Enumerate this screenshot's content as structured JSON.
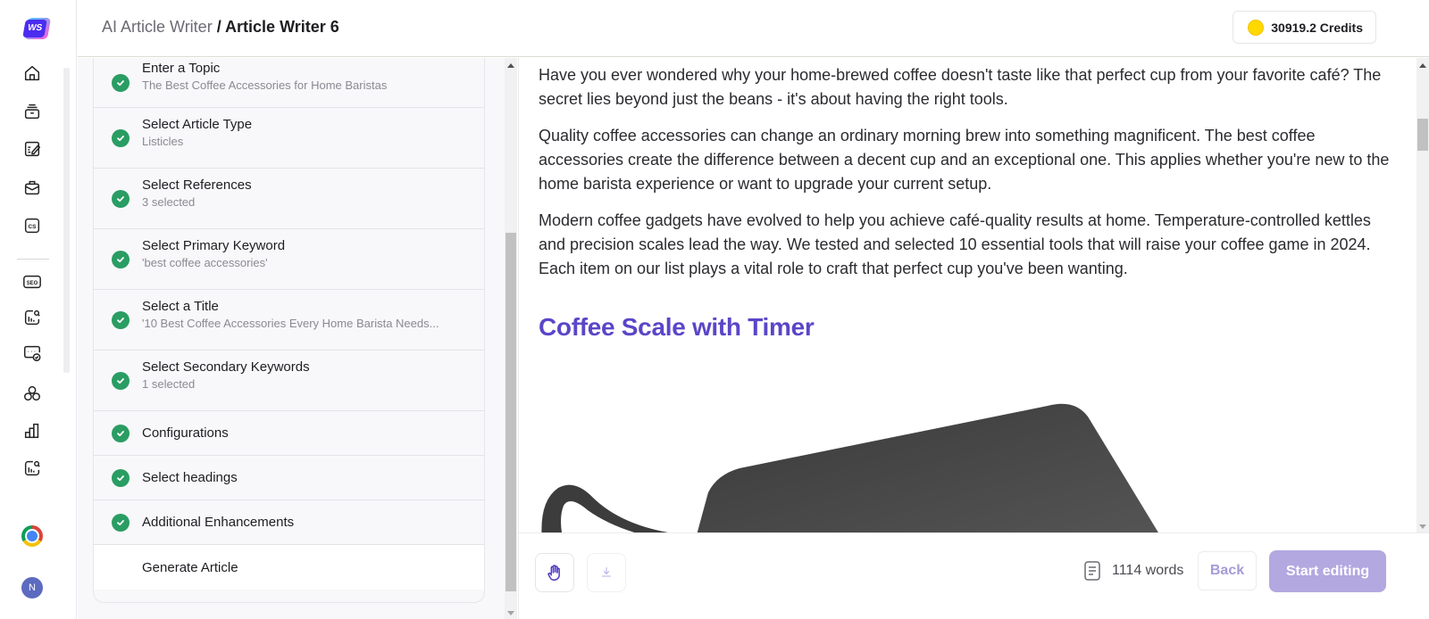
{
  "app": {
    "logo_text": "WS"
  },
  "rail": {
    "items": [
      {
        "icon": "home-icon"
      },
      {
        "icon": "archive-icon"
      },
      {
        "icon": "edit-document-icon"
      },
      {
        "icon": "briefcase-icon"
      },
      {
        "icon": "cs-icon",
        "glyph": "CS"
      },
      {
        "icon": "seo-icon",
        "glyph": "SEO"
      },
      {
        "icon": "analytics-search-icon"
      },
      {
        "icon": "message-check-icon"
      },
      {
        "icon": "community-icon"
      },
      {
        "icon": "bar-chart-icon"
      },
      {
        "icon": "analytics-search-icon-2"
      }
    ],
    "chrome_icon": "chrome-icon",
    "avatar_initial": "N"
  },
  "header": {
    "breadcrumb_root": "AI Article Writer",
    "breadcrumb_sep": " / ",
    "breadcrumb_current": "Article Writer 6",
    "credits": "30919.2 Credits"
  },
  "steps": [
    {
      "title": "Enter a Topic",
      "subtitle": "The Best Coffee Accessories for Home Baristas",
      "done": true
    },
    {
      "title": "Select Article Type",
      "subtitle": "Listicles",
      "done": true
    },
    {
      "title": "Select References",
      "subtitle": "3 selected",
      "done": true
    },
    {
      "title": "Select Primary Keyword",
      "subtitle": "'best coffee accessories'",
      "done": true
    },
    {
      "title": "Select a Title",
      "subtitle": "'10 Best Coffee Accessories Every Home Barista Needs...",
      "done": true
    },
    {
      "title": "Select Secondary Keywords",
      "subtitle": "1 selected",
      "done": true
    },
    {
      "title": "Configurations",
      "done": true
    },
    {
      "title": "Select headings",
      "done": true
    },
    {
      "title": "Additional Enhancements",
      "done": true
    },
    {
      "title": "Generate Article",
      "done": false
    }
  ],
  "article": {
    "paragraphs": [
      "Have you ever wondered why your home-brewed coffee doesn't taste like that perfect cup from your favorite café? The secret lies beyond just the beans - it's about having the right tools.",
      "Quality coffee accessories can change an ordinary morning brew into something magnificent. The best coffee accessories create the difference between a decent cup and an exceptional one. This applies whether you're new to the home barista experience or want to upgrade your current setup.",
      "Modern coffee gadgets have evolved to help you achieve café-quality results at home. Temperature-controlled kettles and precision scales lead the way. We tested and selected 10 essential tools that will raise your coffee game in 2024. Each item on our list plays a vital role to craft that perfect cup you've been wanting."
    ],
    "heading": "Coffee Scale with Timer",
    "image_alt": "coffee-scale-image"
  },
  "footer": {
    "word_count": "1114 words",
    "back_label": "Back",
    "start_editing_label": "Start editing"
  },
  "colors": {
    "accent": "#5a46c8",
    "success": "#2a9d63",
    "primary_button_disabled": "#b3a8e0",
    "coin": "#ffd800"
  }
}
